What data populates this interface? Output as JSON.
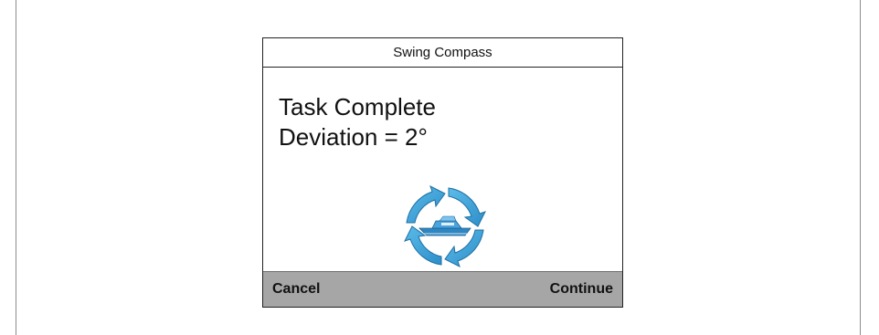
{
  "dialog": {
    "title": "Swing Compass",
    "status_line": "Task Complete",
    "deviation_line": "Deviation = 2°",
    "icon": "rotating-boat-icon"
  },
  "softkeys": {
    "left_label": "Cancel",
    "right_label": "Continue"
  },
  "colors": {
    "arrow_blue": "#3aa1d8",
    "boat_blue": "#2f86c2",
    "softkey_bar": "#a6a6a6"
  }
}
